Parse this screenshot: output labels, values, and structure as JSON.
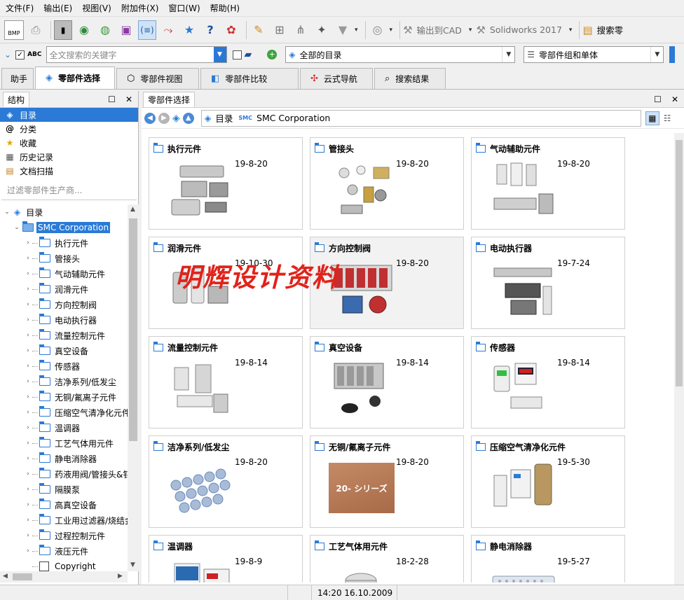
{
  "menu": [
    "文件(F)",
    "输出(E)",
    "视图(V)",
    "附加件(X)",
    "窗口(W)",
    "帮助(H)"
  ],
  "toolbar": {
    "bmp_label": "BMP",
    "export_cad": "输出到CAD",
    "cad_system": "Solidworks 2017",
    "search_label": "搜索零"
  },
  "search": {
    "abc_label": "ABC",
    "placeholder": "全文搜索的关键字",
    "catalog_scope": "全部的目录",
    "result_filter": "零部件组和单体"
  },
  "tabs": [
    "助手",
    "零部件选择",
    "零部件视图",
    "零部件比较",
    "云式导航",
    "搜索结果"
  ],
  "left_panel": {
    "title": "结构",
    "nav": [
      "目录",
      "分类",
      "收藏",
      "历史记录",
      "文档扫描"
    ],
    "filter_placeholder": "过滤零部件生产商...",
    "tree_root": "目录",
    "tree_vendor": "SMC Corporation",
    "tree_items": [
      "执行元件",
      "管接头",
      "气动辅助元件",
      "润滑元件",
      "方向控制阀",
      "电动执行器",
      "流量控制元件",
      "真空设备",
      "传感器",
      "洁净系列/低发尘",
      "无铜/氟离子元件",
      "压缩空气清净化元件",
      "温调器",
      "工艺气体用元件",
      "静电消除器",
      "药液用阀/管接头&钅",
      "隔膜泵",
      "高真空设备",
      "工业用过滤器/烧结金",
      "过程控制元件",
      "液压元件"
    ],
    "tree_doc": "Copyright"
  },
  "right_panel": {
    "title": "零部件选择",
    "breadcrumb_root": "目录",
    "breadcrumb_vendor_logo": "SMC",
    "breadcrumb_vendor": "SMC Corporation"
  },
  "cards": [
    {
      "title": "执行元件",
      "date": "19-8-20"
    },
    {
      "title": "管接头",
      "date": "19-8-20"
    },
    {
      "title": "气动辅助元件",
      "date": "19-8-20"
    },
    {
      "title": "润滑元件",
      "date": "19-10-30"
    },
    {
      "title": "方向控制阀",
      "date": "19-8-20"
    },
    {
      "title": "电动执行器",
      "date": "19-7-24"
    },
    {
      "title": "流量控制元件",
      "date": "19-8-14"
    },
    {
      "title": "真空设备",
      "date": "19-8-14"
    },
    {
      "title": "传感器",
      "date": "19-8-14"
    },
    {
      "title": "洁净系列/低发尘",
      "date": "19-8-20"
    },
    {
      "title": "无铜/氟离子元件",
      "date": "19-8-20",
      "image_text": "20- シリーズ"
    },
    {
      "title": "压缩空气清净化元件",
      "date": "19-5-30"
    },
    {
      "title": "温调器",
      "date": "19-8-9"
    },
    {
      "title": "工艺气体用元件",
      "date": "18-2-28"
    },
    {
      "title": "静电消除器",
      "date": "19-5-27"
    }
  ],
  "watermark": "明辉设计资料",
  "status": {
    "datetime": "14:20 16.10.2009"
  },
  "colors": {
    "selection": "#2a7ad6",
    "folder": "#2b7bd6",
    "watermark": "#e0231b"
  }
}
